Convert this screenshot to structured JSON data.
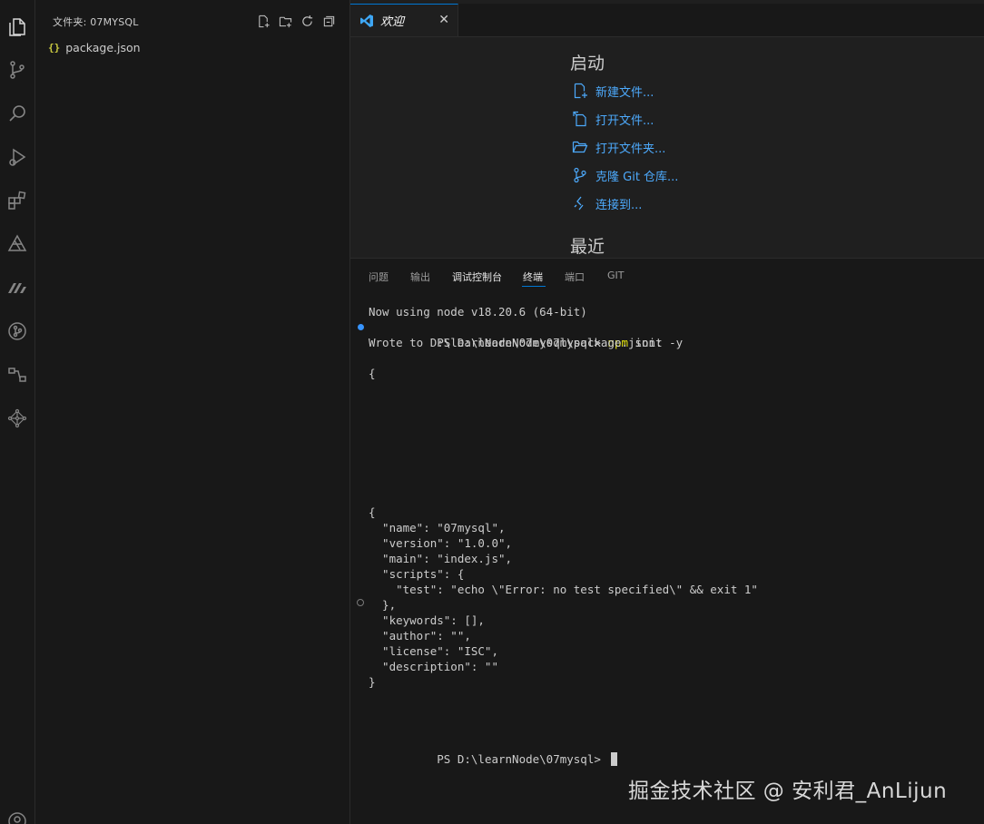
{
  "sidebar": {
    "title": "文件夹: 07MYSQL",
    "files": [
      {
        "icon": "{}",
        "name": "package.json"
      }
    ]
  },
  "editor": {
    "tab": {
      "label": "欢迎"
    },
    "welcome": {
      "start_heading": "启动",
      "start_items": [
        {
          "label": "新建文件...",
          "icon": "new-file-icon"
        },
        {
          "label": "打开文件...",
          "icon": "open-file-icon"
        },
        {
          "label": "打开文件夹...",
          "icon": "open-folder-icon"
        },
        {
          "label": "克隆 Git 仓库...",
          "icon": "git-clone-icon"
        },
        {
          "label": "连接到...",
          "icon": "remote-connect-icon"
        }
      ],
      "recent_heading": "最近"
    }
  },
  "panel": {
    "tabs": [
      "问题",
      "输出",
      "调试控制台",
      "终端",
      "端口",
      "GIT"
    ],
    "active_tab": "终端"
  },
  "terminal": {
    "line1": "Now using node v18.20.6 (64-bit)",
    "prompt": "PS D:\\learnNode\\07mysql> ",
    "cmd_npm": "npm",
    "cmd_args": " init -y",
    "wrote": "Wrote to D:\\learnNode\\07mysql\\package.json:",
    "brace_open": "{",
    "json_lines": [
      "{",
      "  \"name\": \"07mysql\",",
      "  \"version\": \"1.0.0\",",
      "  \"main\": \"index.js\",",
      "  \"scripts\": {",
      "    \"test\": \"echo \\\"Error: no test specified\\\" && exit 1\"",
      "  },",
      "  \"keywords\": [],",
      "  \"author\": \"\",",
      "  \"license\": \"ISC\",",
      "  \"description\": \"\"",
      "}"
    ],
    "final_prompt": "PS D:\\learnNode\\07mysql> "
  },
  "watermark": "掘金技术社区 @ 安利君_AnLijun",
  "colors": {
    "accent": "#0078d4",
    "link": "#4daafc",
    "npm_cmd": "#e5e510"
  }
}
